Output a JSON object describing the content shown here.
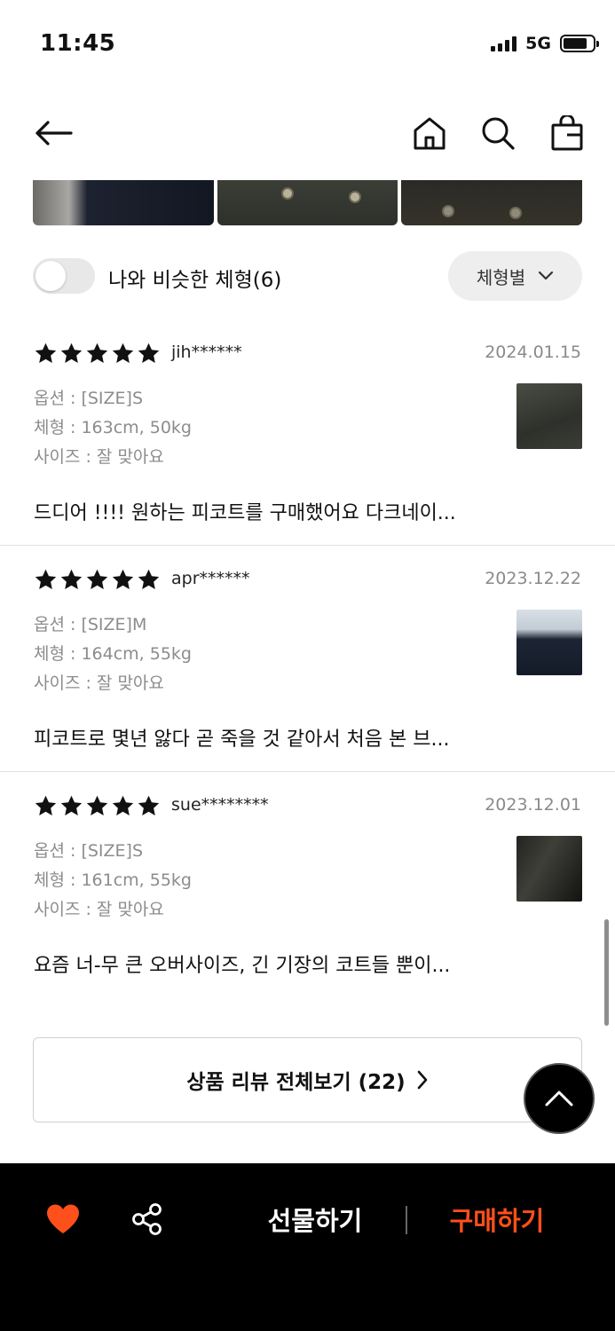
{
  "status_bar": {
    "time": "11:45",
    "network": "5G"
  },
  "icons": {
    "back": "arrow-left-icon",
    "home": "home-icon",
    "search": "search-icon",
    "bag": "shopping-bag-icon",
    "star": "star-icon",
    "chevron_down": "chevron-down-icon",
    "chevron_right": "chevron-right-icon",
    "scroll_top": "chevron-up-icon",
    "heart": "heart-icon",
    "share": "share-icon"
  },
  "filter": {
    "toggle_label": "나와 비슷한 체형(6)",
    "toggle_on": false,
    "sort_label": "체형별"
  },
  "reviews": [
    {
      "rating": 5,
      "reviewer": "jih******",
      "date": "2024.01.15",
      "option": "옵션 : [SIZE]S",
      "body": "체형 : 163cm, 50kg",
      "fit": "사이즈 : 잘 맞아요",
      "text": "드디어 !!!! 원하는 피코트를 구매했어요 다크네이..."
    },
    {
      "rating": 5,
      "reviewer": "apr******",
      "date": "2023.12.22",
      "option": "옵션 : [SIZE]M",
      "body": "체형 : 164cm, 55kg",
      "fit": "사이즈 : 잘 맞아요",
      "text": "피코트로 몇년 앓다 곧 죽을 것 같아서 처음 본 브..."
    },
    {
      "rating": 5,
      "reviewer": "sue********",
      "date": "2023.12.01",
      "option": "옵션 : [SIZE]S",
      "body": "체형 : 161cm, 55kg",
      "fit": "사이즈 : 잘 맞아요",
      "text": "요즘 너-무 큰 오버사이즈, 긴 기장의 코트들 뿐이..."
    }
  ],
  "view_all_label": "상품 리뷰 전체보기 (22)",
  "bottom_bar": {
    "gift_label": "선물하기",
    "buy_label": "구매하기"
  },
  "colors": {
    "accent": "#ff4f1a",
    "heart": "#ff4f1a",
    "bottom_bar_bg": "#000000"
  }
}
